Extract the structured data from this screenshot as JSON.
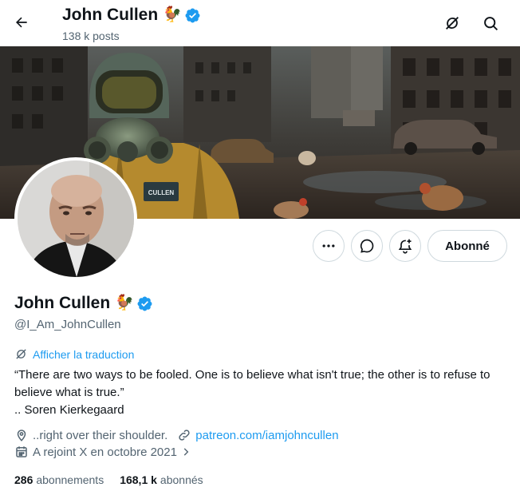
{
  "header": {
    "name": "John Cullen",
    "emoji": "🐓",
    "posts": "138 k posts"
  },
  "profile": {
    "name": "John Cullen",
    "emoji": "🐓",
    "handle": "@I_Am_JohnCullen",
    "follow_label": "Abonné",
    "translate_label": "Afficher la traduction",
    "bio_line1": "“There are two ways to be fooled. One is to believe what isn't true; the other is to refuse to believe what is true.”",
    "bio_line2": ".. Soren Kierkegaard",
    "location": "..right over their shoulder.",
    "website": "patreon.com/iamjohncullen",
    "joined": "A rejoint X en octobre 2021",
    "following_count": "286",
    "following_label": "abonnements",
    "followers_count": "168,1 k",
    "followers_label": "abonnés"
  },
  "banner_text": "CULLEN",
  "colors": {
    "accent": "#1d9bf0",
    "verified": "#1d9bf0",
    "secondary_text": "#536471"
  },
  "icons": {
    "back": "arrow-left-icon",
    "translate_top": "translate-slash-icon",
    "search": "search-icon",
    "more": "more-dots-icon",
    "message": "message-bubble-icon",
    "notify": "bell-plus-icon",
    "location": "location-pin-icon",
    "link": "link-chain-icon",
    "calendar": "calendar-icon",
    "chevron": "chevron-right-icon"
  }
}
